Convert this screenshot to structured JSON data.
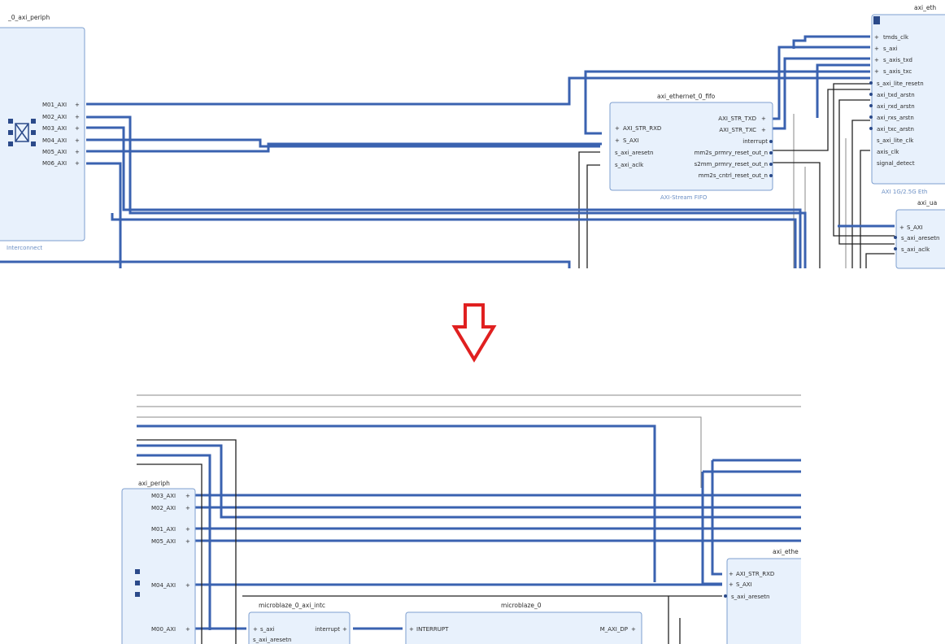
{
  "top": {
    "interconnect": {
      "title": "_0_axi_periph",
      "footer": "Interconnect",
      "ports": [
        "M01_AXI",
        "M02_AXI",
        "M03_AXI",
        "M04_AXI",
        "M05_AXI",
        "M06_AXI"
      ]
    },
    "fifo": {
      "title": "axi_ethernet_0_fifo",
      "subtitle": "AXI-Stream FIFO",
      "left_ports": [
        "AXI_STR_RXD",
        "S_AXI",
        "s_axi_aresetn",
        "s_axi_aclk"
      ],
      "right_ports": [
        "AXI_STR_TXD",
        "AXI_STR_TXC",
        "interrupt",
        "mm2s_prmry_reset_out_n",
        "s2mm_prmry_reset_out_n",
        "mm2s_cntrl_reset_out_n"
      ]
    },
    "ethernet": {
      "title": "axi_eth",
      "subtitle": "AXI 1G/2.5G Eth",
      "ports": [
        "tmds_clk",
        "s_axi",
        "s_axis_txd",
        "s_axis_txc",
        "s_axi_lite_resetn",
        "axi_txd_arstn",
        "axi_rxd_arstn",
        "axi_rxs_arstn",
        "axi_txc_arstn",
        "s_axi_lite_clk",
        "axis_clk",
        "signal_detect"
      ]
    },
    "uart": {
      "title": "axi_ua",
      "ports": [
        "S_AXI",
        "s_axi_aresetn",
        "s_axi_aclk"
      ]
    }
  },
  "bottom": {
    "interconnect": {
      "title": "axi_periph",
      "ports": [
        "M03_AXI",
        "M02_AXI",
        "M01_AXI",
        "M05_AXI",
        "M04_AXI",
        "M00_AXI"
      ]
    },
    "intc": {
      "title": "microblaze_0_axi_intc",
      "left_ports": [
        "s_axi",
        "s_axi_aresetn"
      ],
      "right_ports": [
        "interrupt"
      ]
    },
    "microblaze": {
      "title": "microblaze_0",
      "left_ports": [
        "INTERRUPT"
      ],
      "right_ports": [
        "M_AXI_DP"
      ]
    },
    "ethernet": {
      "title": "axi_ethe",
      "ports": [
        "AXI_STR_RXD",
        "S_AXI",
        "s_axi_aresetn"
      ]
    }
  },
  "arrow": {
    "color": "#e02020",
    "icon": "down-arrow-icon"
  }
}
